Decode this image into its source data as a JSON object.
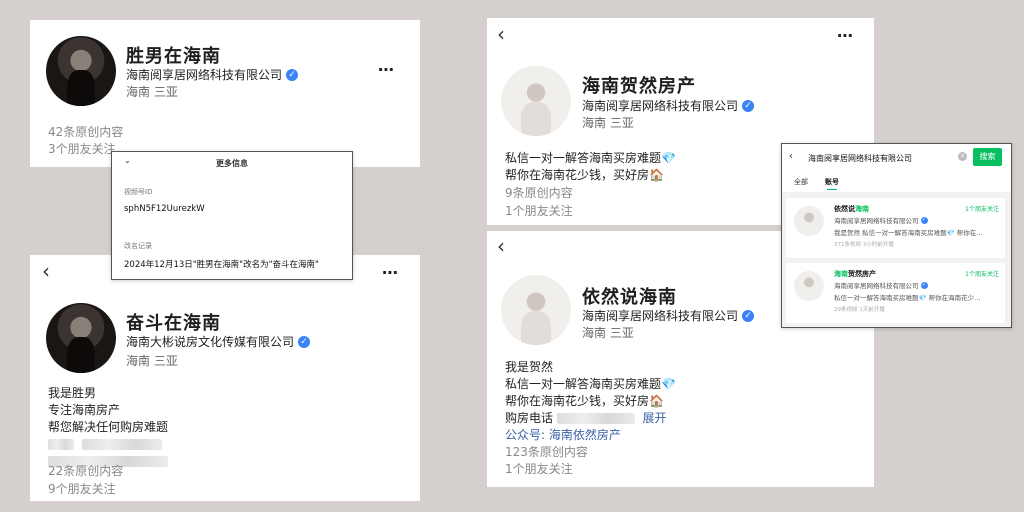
{
  "cards": {
    "shengnan": {
      "name": "胜男在海南",
      "company": "海南阅享居网络科技有限公司",
      "location": "海南 三亚",
      "posts": "42条原创内容",
      "friends": "3个朋友关注"
    },
    "fendou": {
      "name": "奋斗在海南",
      "company": "海南大彬说房文化传媒有限公司",
      "location": "海南 三亚",
      "bio": [
        "我是胜男",
        "专注海南房产",
        "帮您解决任何购房难题"
      ],
      "posts": "22条原创内容",
      "friends": "9个朋友关注"
    },
    "heran": {
      "name": "海南贺然房产",
      "company": "海南阅享居网络科技有限公司",
      "location": "海南 三亚",
      "bio": [
        "私信一对一解答海南买房难题💎",
        "帮你在海南花少钱，买好房🏠"
      ],
      "posts": "9条原创内容",
      "friends": "1个朋友关注"
    },
    "yiran": {
      "name": "依然说海南",
      "company": "海南阅享居网络科技有限公司",
      "location": "海南 三亚",
      "bio": [
        "我是贺然",
        "私信一对一解答海南买房难题💎",
        "帮你在海南花少钱，买好房🏠"
      ],
      "phone_label": "购房电话",
      "expand": "展开",
      "public_account": "公众号: 海南依然房产",
      "posts": "123条原创内容",
      "friends": "1个朋友关注"
    }
  },
  "info_popup": {
    "title": "更多信息",
    "id_label": "视频号ID",
    "id_value": "sphN5F12UurezkW",
    "rename_label": "改名记录",
    "rename_value": "2024年12月13日\"胜男在海南\"改名为\"奋斗在海南\""
  },
  "search_popup": {
    "query": "海南阅享居网络科技有限公司",
    "button": "搜索",
    "tabs": [
      "全部",
      "账号"
    ],
    "results": [
      {
        "name_prefix": "依然说",
        "name_highlight": "海南",
        "name_suffix": "",
        "follow": "1个朋友关注",
        "company": "海南阅享居网络科技有限公司",
        "desc": "我是贺然 私信一对一解答海南买房难题💎 帮你在…",
        "meta": "371条视频  3小时前开播"
      },
      {
        "name_prefix": "",
        "name_highlight": "海南",
        "name_suffix": "贺然房产",
        "follow": "1个朋友关注",
        "company": "海南阅享居网络科技有限公司",
        "desc": "私信一对一解答海南买房难题💎 帮你在海南花少…",
        "meta": "29条视频  1天前开播"
      }
    ]
  },
  "icons": {
    "more": "⋯",
    "back": "‹",
    "verified": "✓"
  }
}
